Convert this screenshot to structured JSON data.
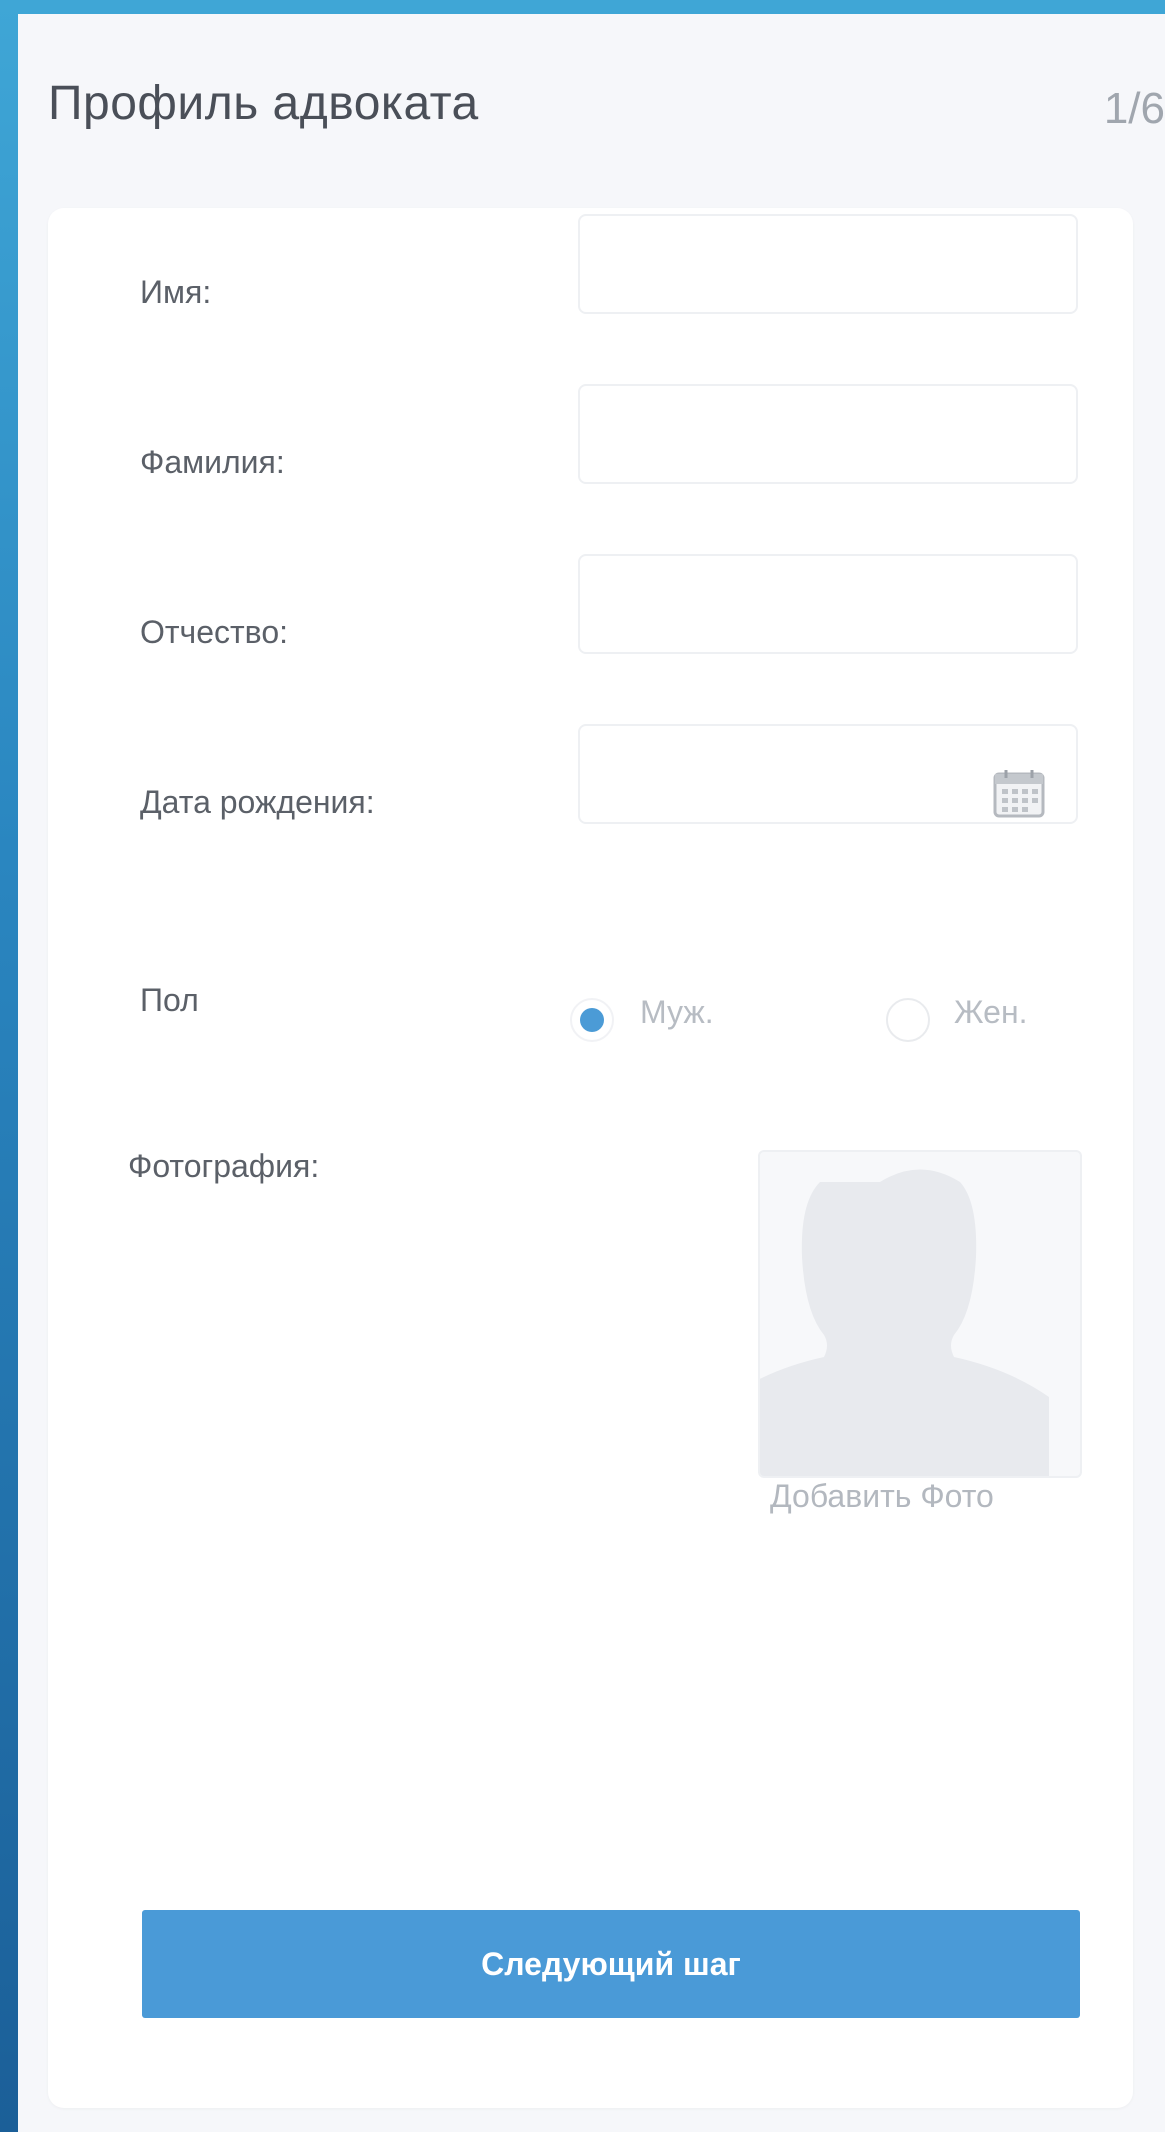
{
  "header": {
    "title": "Профиль адвоката",
    "step": "1/6"
  },
  "form": {
    "first_name": {
      "label": "Имя:",
      "value": ""
    },
    "last_name": {
      "label": "Фамилия:",
      "value": ""
    },
    "patronymic": {
      "label": "Отчество:",
      "value": ""
    },
    "birth_date": {
      "label": "Дата рождения:",
      "value": "",
      "icon": "calendar-icon"
    },
    "gender": {
      "label": "Пол",
      "options": [
        {
          "label": "Муж.",
          "selected": true
        },
        {
          "label": "Жен.",
          "selected": false
        }
      ]
    },
    "photo": {
      "label": "Фотография:",
      "placeholder_icon": "avatar-silhouette-icon",
      "add_label": "Добавить Фото"
    }
  },
  "actions": {
    "next_label": "Следующий шаг"
  },
  "colors": {
    "accent": "#4a9ad7",
    "background": "#f6f7fa",
    "card": "#ffffff",
    "frame_gradient_top": "#3fa6d6",
    "frame_gradient_bottom": "#1b5f98"
  }
}
